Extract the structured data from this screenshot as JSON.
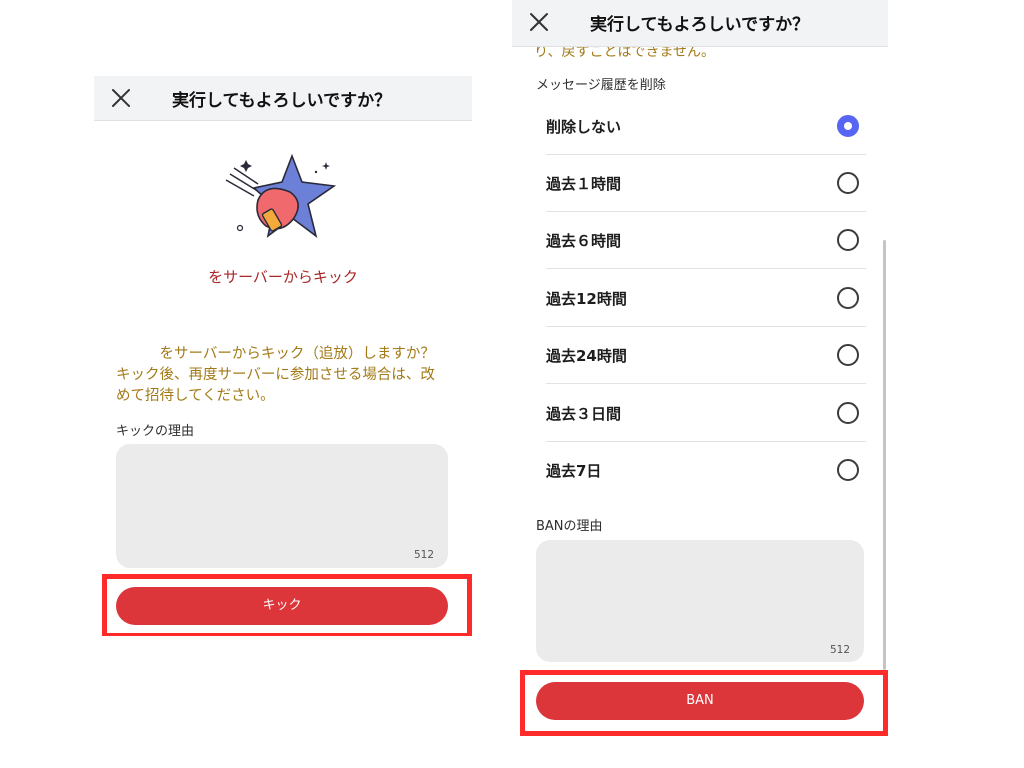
{
  "left": {
    "header_title": "実行してもよろしいですか？",
    "kick_title": "をサーバーからキック",
    "description": "　　　をサーバーからキック（追放）しますか？　キック後、再度サーバーに参加させる場合は、改めて招待してください。",
    "reason_label": "キックの理由",
    "reason_counter": "512",
    "kick_button": "キック"
  },
  "right": {
    "header_title": "実行してもよろしいですか？",
    "clipped_text": "り、戻すことはできません。",
    "history_label": "メッセージ履歴を削除",
    "options": [
      {
        "label": "削除しない",
        "selected": true
      },
      {
        "label": "過去１時間",
        "selected": false
      },
      {
        "label": "過去６時間",
        "selected": false
      },
      {
        "label": "過去12時間",
        "selected": false
      },
      {
        "label": "過去24時間",
        "selected": false
      },
      {
        "label": "過去３日間",
        "selected": false
      },
      {
        "label": "過去7日",
        "selected": false
      }
    ],
    "reason_label": "BANの理由",
    "reason_counter": "512",
    "ban_button": "BAN"
  },
  "colors": {
    "accent_red": "#dc363b",
    "highlight_red": "#ff2a2a",
    "radio_selected": "#5865f2",
    "warning_text": "#a37a17",
    "kick_title": "#a8282a"
  },
  "icons": [
    "close-icon",
    "kick-star-illustration",
    "radio-selected-icon",
    "radio-unselected-icon"
  ]
}
